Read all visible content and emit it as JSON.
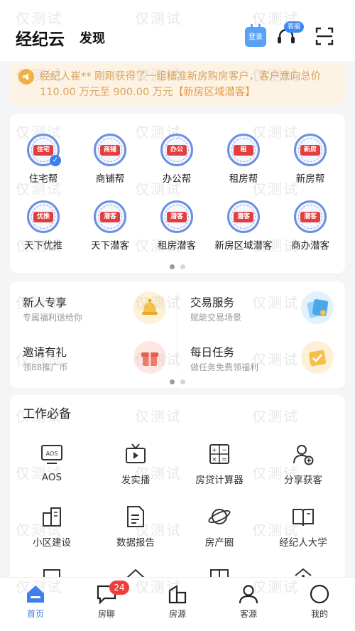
{
  "header": {
    "app_title": "经纪云",
    "tab_discover": "发现",
    "login_label": "登录",
    "service_badge": "客服"
  },
  "notice": {
    "text": "经纪人崔** 刚刚获得了一组精准新房购房客户，客户意向总价 110.00 万元至 900.00 万元",
    "link": "【新房区域潜客】"
  },
  "grid": {
    "items": [
      {
        "label": "住宅帮",
        "tag": "住宅",
        "checked": true
      },
      {
        "label": "商铺帮",
        "tag": "商铺"
      },
      {
        "label": "办公帮",
        "tag": "办公"
      },
      {
        "label": "租房帮",
        "tag": "租"
      },
      {
        "label": "新房帮",
        "tag": "新房"
      },
      {
        "label": "天下优推",
        "tag": "优推"
      },
      {
        "label": "天下潜客",
        "tag": "潜客"
      },
      {
        "label": "租房潜客",
        "tag": "潜客"
      },
      {
        "label": "新房区域潜客",
        "tag": "潜客"
      },
      {
        "label": "商办潜客",
        "tag": "潜客"
      }
    ]
  },
  "features": [
    {
      "title": "新人专享",
      "subtitle": "专属福利送给你",
      "icon": "bell-gift-icon",
      "color": "#f7c24a"
    },
    {
      "title": "交易服务",
      "subtitle": "赋能交易场景",
      "icon": "cards-icon",
      "color": "#5fb8f0"
    },
    {
      "title": "邀请有礼",
      "subtitle": "领88推广币",
      "icon": "gift-icon",
      "color": "#f07a6a"
    },
    {
      "title": "每日任务",
      "subtitle": "做任务免费领福利",
      "icon": "calendar-check-icon",
      "color": "#f5c04a"
    }
  ],
  "work": {
    "title": "工作必备",
    "items": [
      {
        "label": "AOS",
        "icon": "aos-icon"
      },
      {
        "label": "发实播",
        "icon": "live-tv-icon"
      },
      {
        "label": "房贷计算器",
        "icon": "calculator-icon"
      },
      {
        "label": "分享获客",
        "icon": "add-user-icon"
      },
      {
        "label": "小区建设",
        "icon": "building-icon"
      },
      {
        "label": "数据报告",
        "icon": "report-icon"
      },
      {
        "label": "房产圈",
        "icon": "planet-icon"
      },
      {
        "label": "经纪人大学",
        "icon": "book-icon"
      }
    ]
  },
  "tabbar": {
    "items": [
      {
        "label": "首页",
        "icon": "home-icon"
      },
      {
        "label": "房聊",
        "icon": "chat-icon",
        "badge": "24"
      },
      {
        "label": "房源",
        "icon": "house-icon"
      },
      {
        "label": "客源",
        "icon": "customer-icon"
      },
      {
        "label": "我的",
        "icon": "profile-icon"
      }
    ]
  },
  "watermark": "仅测试",
  "colors": {
    "accent": "#3d7ef0",
    "notice_bg": "#fdf3e4",
    "notice_text": "#d9a35e",
    "badge_red": "#ef3d3d"
  }
}
